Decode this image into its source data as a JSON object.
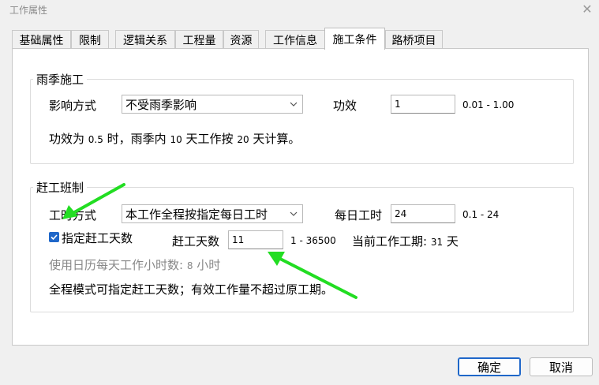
{
  "window": {
    "title": "工作属性",
    "close_symbol": "✕"
  },
  "tabs": [
    {
      "label": "基础属性",
      "active": false
    },
    {
      "label": "限制",
      "active": false
    },
    {
      "label": "逻辑关系",
      "active": false
    },
    {
      "label": "工程量",
      "active": false
    },
    {
      "label": "资源",
      "active": false
    },
    {
      "label": "工作信息",
      "active": false
    },
    {
      "label": "施工条件",
      "active": true
    },
    {
      "label": "路桥项目",
      "active": false
    }
  ],
  "rain": {
    "group_title": "雨季施工",
    "impact_label": "影响方式",
    "impact_value": "不受雨季影响",
    "efficiency_label": "功效",
    "efficiency_value": "1",
    "efficiency_range": "0.01 - 1.00",
    "note": {
      "p1": "功效为",
      "v1": "0.5",
      "p2": "时，雨季内",
      "v2": "10",
      "p3": "天工作按",
      "v3": "20",
      "p4": "天计算。"
    }
  },
  "rush": {
    "group_title": "赶工班制",
    "mode_label": "工时方式",
    "mode_value": "本工作全程按指定每日工时",
    "daily_hours_label": "每日工时",
    "daily_hours_value": "24",
    "daily_hours_range": "0.1 - 24",
    "specify_days_label": "指定赶工天数",
    "specify_days_checked": true,
    "rush_days_label": "赶工天数",
    "rush_days_value": "11",
    "rush_days_range": "1 - 36500",
    "current_period_label": "当前工作工期:",
    "current_period_value": "31",
    "current_period_unit": "天",
    "calendar_hours": {
      "p1": "使用日历每天工作小时数:",
      "v1": "8",
      "p2": "小时"
    },
    "note": "全程模式可指定赶工天数；有效工作量不超过原工期。"
  },
  "buttons": {
    "ok": "确定",
    "cancel": "取消"
  },
  "colors": {
    "accent": "#1f67c9",
    "annotation_arrow": "#22dd22"
  }
}
